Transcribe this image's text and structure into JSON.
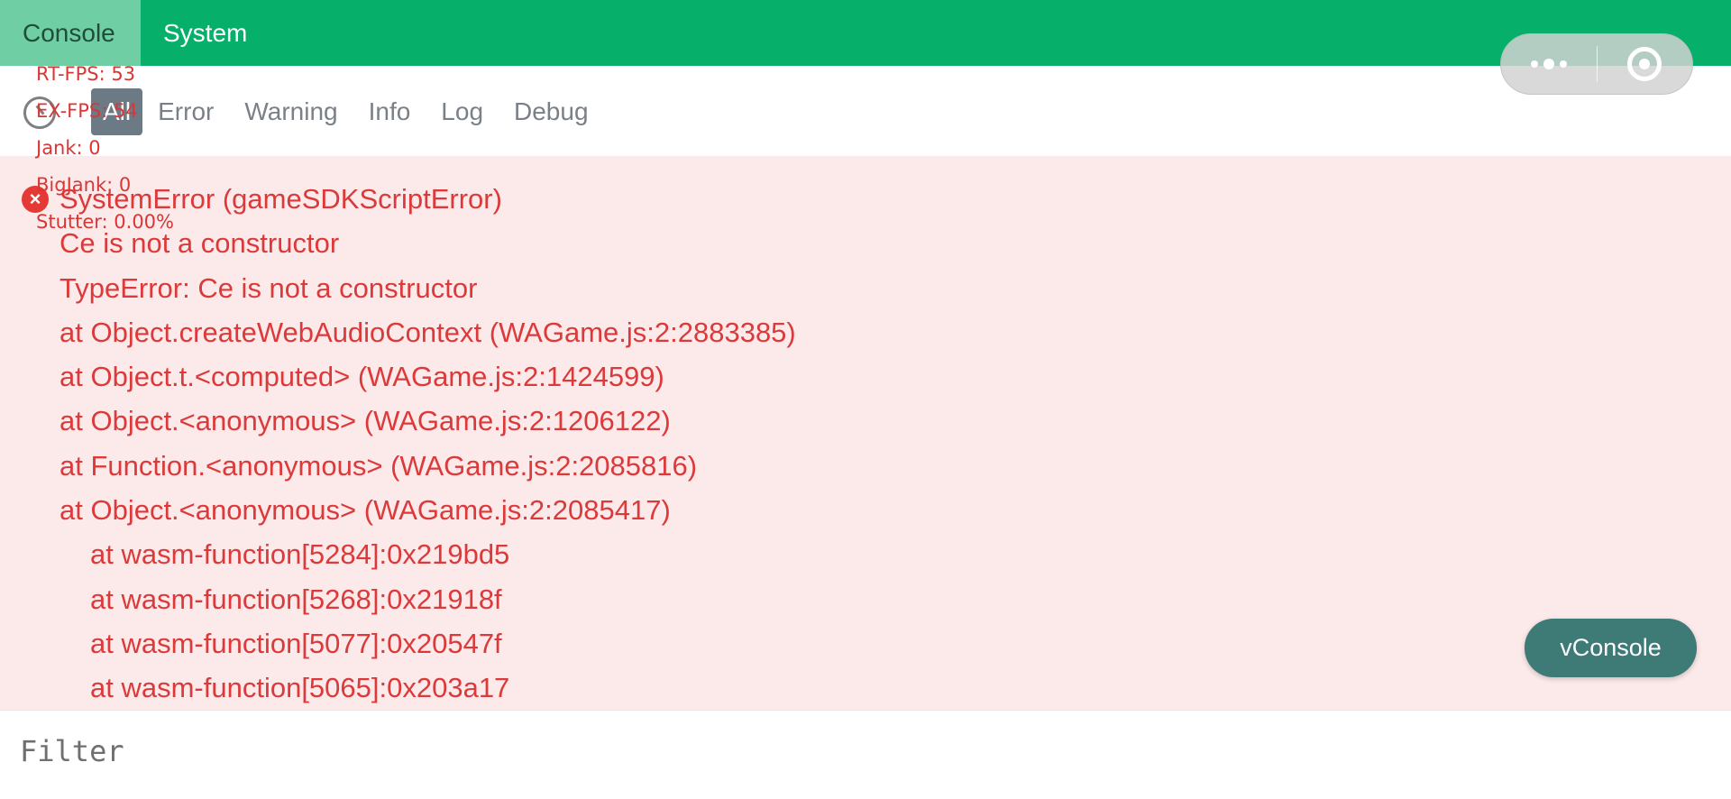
{
  "topbar": {
    "tabs": [
      {
        "label": "Console",
        "active": true
      },
      {
        "label": "System",
        "active": false
      }
    ]
  },
  "capsule": {
    "more_icon": "more-dots-icon",
    "close_icon": "close-ring-icon"
  },
  "levels": {
    "tabs": [
      "All",
      "Error",
      "Warning",
      "Info",
      "Log",
      "Debug"
    ],
    "active": "All"
  },
  "perf": {
    "rt_fps": "RT-FPS: 53",
    "ex_fps": "EX-FPS: 54",
    "jank": "Jank: 0",
    "bigjank": "BigJank: 0",
    "stutter": "Stutter: 0.00%"
  },
  "log": {
    "lines": [
      "SystemError (gameSDKScriptError)",
      "Ce is not a constructor",
      "TypeError: Ce is not a constructor",
      "at Object.createWebAudioContext (WAGame.js:2:2883385)",
      "at Object.t.<computed> (WAGame.js:2:1424599)",
      "at Object.<anonymous> (WAGame.js:2:1206122)",
      "at Function.<anonymous> (WAGame.js:2:2085816)",
      "at Object.<anonymous> (WAGame.js:2:2085417)",
      "at wasm-function[5284]:0x219bd5",
      "at wasm-function[5268]:0x21918f",
      "at wasm-function[5077]:0x20547f",
      "at wasm-function[5065]:0x203a17"
    ]
  },
  "vconsole_button": "vConsole",
  "filter": {
    "placeholder": "Filter",
    "value": ""
  },
  "colors": {
    "topbar": "#07b06a",
    "error_text": "#dc3a3a",
    "error_bg": "#fce9ea",
    "vconsole_btn": "#3e7a76"
  }
}
